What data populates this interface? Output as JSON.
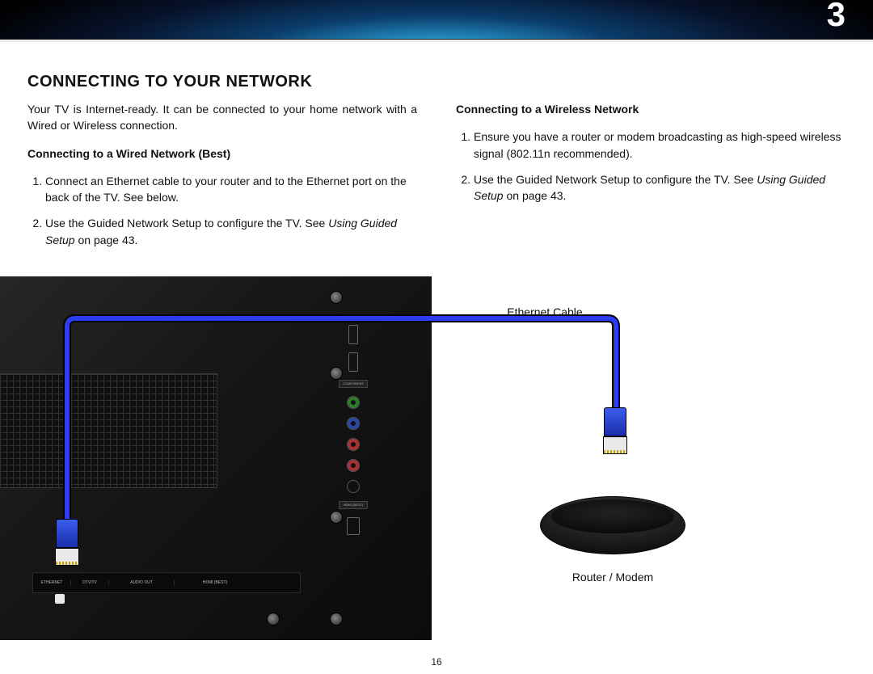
{
  "chapter_number": "3",
  "section_title": "CONNECTING TO YOUR NETWORK",
  "intro": "Your TV is Internet-ready. It can be connected to your home network with a Wired or Wireless connection.",
  "wired": {
    "heading": "Connecting to a Wired Network (Best)",
    "steps": [
      "Connect an Ethernet cable to your router and to the Ethernet port on the back of the TV. See below.",
      "Use the Guided Network Setup to configure the TV. See "
    ],
    "ref_text": "Using Guided Setup",
    "ref_suffix": " on page 43."
  },
  "wireless": {
    "heading": "Connecting to a Wireless Network",
    "steps": [
      "Ensure you have a router or modem broadcasting as high-speed wireless signal (802.11n recommended).",
      "Use the Guided Network Setup to configure the TV. See "
    ],
    "ref_text": "Using Guided Setup",
    "ref_suffix": " on page 43."
  },
  "labels": {
    "ethernet_cable": "Ethernet Cable",
    "router_modem": "Router / Modem"
  },
  "bottom_ports": [
    "ETHERNET",
    "DTV/TV",
    "AUDIO OUT",
    "HDMI (BEST)"
  ],
  "side_labels": {
    "component": "COMPONENT",
    "hdmi": "HDMI (BEST)"
  },
  "page_number": "16",
  "colors": {
    "cable_blue": "#2a3df0"
  }
}
